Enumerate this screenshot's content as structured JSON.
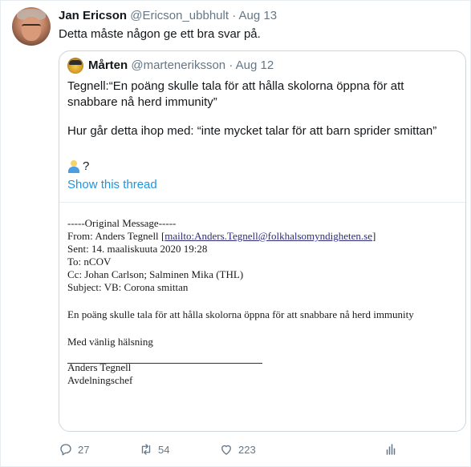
{
  "tweet": {
    "display_name": "Jan Ericson",
    "handle": "@Ericson_ubbhult",
    "separator": "·",
    "date": "Aug 13",
    "text": "Detta måste någon ge ett bra svar på."
  },
  "quoted": {
    "display_name": "Mårten",
    "handle": "@marteneriksson",
    "separator": "·",
    "date": "Aug 12",
    "line1": "Tegnell:“En poäng skulle tala för att hålla skolorna öppna för att snabbare nå herd immunity”",
    "line2": "Hur går detta ihop med: “inte mycket talar för att barn sprider smittan”",
    "line3_suffix": "?",
    "emoji_icon": "person-shrugging-icon",
    "show_thread": "Show this thread"
  },
  "email": {
    "header": "-----Original Message-----",
    "from_label": "From: Anders Tegnell ",
    "from_bracket_open": "[",
    "from_link": "mailto:Anders.Tegnell@folkhalsomyndigheten.se",
    "from_bracket_close": "]",
    "sent": "Sent: 14. maaliskuuta 2020 19:28",
    "to": "To: nCOV",
    "cc": "Cc: Johan Carlson; Salminen Mika (THL)",
    "subject": "Subject: VB: Corona smittan",
    "body": "En poäng skulle tala för att hålla skolorna öppna för att snabbare nå herd immunity",
    "greeting": "Med vänlig hälsning",
    "sig_name": "Anders Tegnell",
    "sig_title": "Avdelningschef"
  },
  "actions": {
    "reply_count": "27",
    "retweet_count": "54",
    "like_count": "223",
    "icons": [
      "reply-icon",
      "retweet-icon",
      "like-icon",
      "share-icon"
    ]
  },
  "colors": {
    "link": "#1b95e0",
    "muted": "#657786",
    "border": "#ccd6dd"
  }
}
